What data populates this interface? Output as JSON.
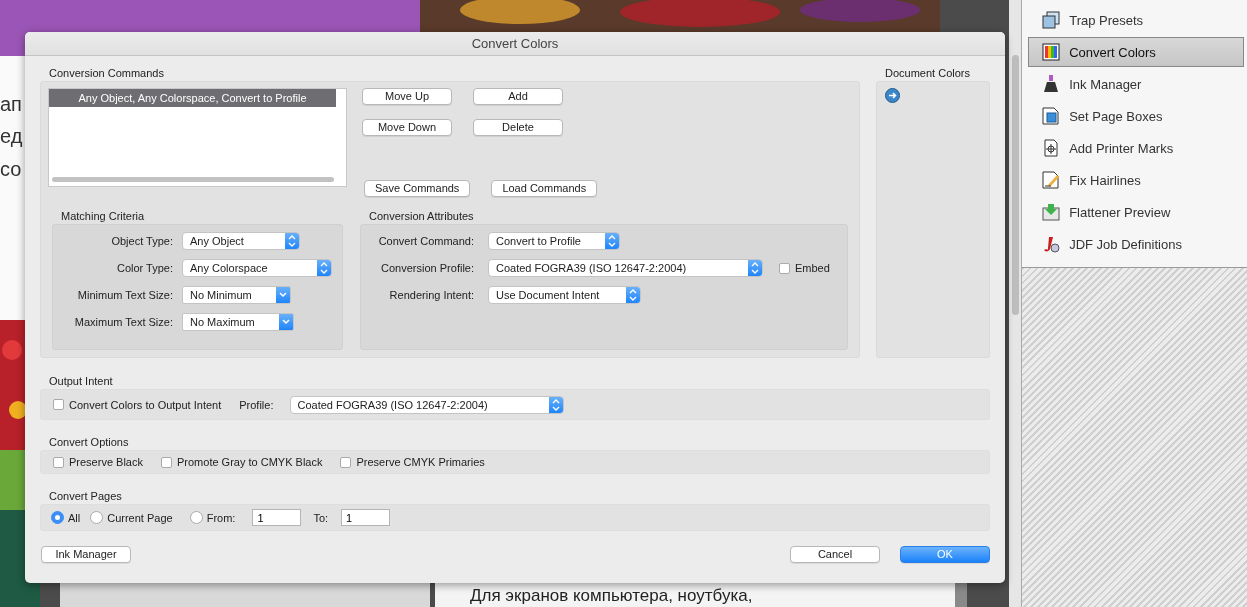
{
  "background": {
    "text_fragments": [
      "ап",
      "ед",
      "со"
    ],
    "caption": "Для экранов компьютера, ноутбука,"
  },
  "sidebar": {
    "items": [
      {
        "label": "Trap Presets",
        "selected": false
      },
      {
        "label": "Convert Colors",
        "selected": true
      },
      {
        "label": "Ink Manager",
        "selected": false
      },
      {
        "label": "Set Page Boxes",
        "selected": false
      },
      {
        "label": "Add Printer Marks",
        "selected": false
      },
      {
        "label": "Fix Hairlines",
        "selected": false
      },
      {
        "label": "Flattener Preview",
        "selected": false
      },
      {
        "label": "JDF Job Definitions",
        "selected": false
      }
    ]
  },
  "dialog": {
    "title": "Convert Colors",
    "conversion_commands": {
      "label": "Conversion Commands",
      "items": [
        {
          "text": "Any Object, Any Colorspace, Convert to Profile",
          "selected": true
        }
      ],
      "buttons": [
        "Move Up",
        "Add",
        "Move Down",
        "Delete"
      ],
      "file_buttons": [
        "Save Commands",
        "Load Commands"
      ]
    },
    "matching_criteria": {
      "label": "Matching Criteria",
      "fields": [
        {
          "label": "Object Type:",
          "value": "Any Object",
          "kind": "popup"
        },
        {
          "label": "Color Type:",
          "value": "Any Colorspace",
          "kind": "popup"
        },
        {
          "label": "Minimum Text Size:",
          "value": "No Minimum",
          "kind": "combo"
        },
        {
          "label": "Maximum Text Size:",
          "value": "No Maximum",
          "kind": "combo"
        }
      ]
    },
    "conversion_attributes": {
      "label": "Conversion Attributes",
      "fields": [
        {
          "label": "Convert Command:",
          "value": "Convert to Profile",
          "kind": "popup"
        },
        {
          "label": "Conversion Profile:",
          "value": "Coated FOGRA39 (ISO 12647-2:2004)",
          "kind": "popup"
        },
        {
          "label": "Rendering Intent:",
          "value": "Use Document Intent",
          "kind": "popup"
        }
      ],
      "embed": {
        "label": "Embed",
        "checked": false
      }
    },
    "document_colors": {
      "label": "Document Colors"
    },
    "output_intent": {
      "label": "Output Intent",
      "convert": {
        "label": "Convert Colors to Output Intent",
        "checked": false
      },
      "profile_label": "Profile:",
      "profile": "Coated FOGRA39 (ISO 12647-2:2004)"
    },
    "convert_options": {
      "label": "Convert Options",
      "options": [
        {
          "label": "Preserve Black",
          "checked": false
        },
        {
          "label": "Promote Gray to CMYK Black",
          "checked": false
        },
        {
          "label": "Preserve CMYK Primaries",
          "checked": false
        }
      ]
    },
    "convert_pages": {
      "label": "Convert Pages",
      "options": [
        {
          "label": "All",
          "selected": true
        },
        {
          "label": "Current Page",
          "selected": false
        },
        {
          "label": "From:",
          "selected": false
        }
      ],
      "from": "1",
      "to_label": "To:",
      "to": "1"
    },
    "buttons": [
      {
        "label": "Ink Manager",
        "kind": "plain"
      },
      {
        "label": "Cancel",
        "kind": "plain"
      },
      {
        "label": "OK",
        "kind": "default"
      }
    ]
  }
}
